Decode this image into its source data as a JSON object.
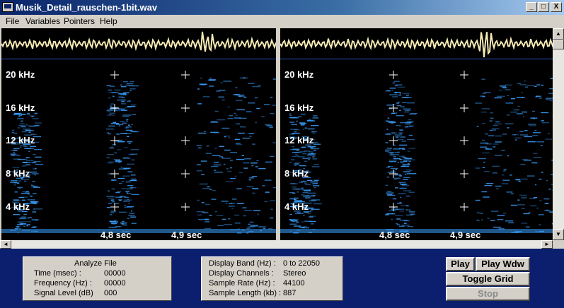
{
  "window": {
    "title": "Musik_Detail_rauschen-1bit.wav",
    "minimize": "_",
    "maximize": "□",
    "close": "X"
  },
  "menu": {
    "items": [
      "File",
      "Variables",
      "Pointers",
      "Help"
    ]
  },
  "spectrogram": {
    "freq_labels": [
      "20 kHz",
      "16 kHz",
      "12 kHz",
      "8  kHz",
      "4  kHz"
    ],
    "time_labels": [
      "4,8 sec",
      "4,9 sec"
    ],
    "colors": {
      "background": "#000000",
      "energy": "#3aa0ff",
      "waveform": "#f5eab4"
    }
  },
  "analyze": {
    "title": "Analyze File",
    "rows": [
      {
        "label": "Time (msec) :",
        "value": "00000"
      },
      {
        "label": "Frequency (Hz) :",
        "value": "00000"
      },
      {
        "label": "Signal Level (dB)",
        "value": "000"
      }
    ]
  },
  "display": {
    "rows": [
      {
        "label": "Display Band (Hz) :",
        "value": "0 to 22050"
      },
      {
        "label": "Display Channels :",
        "value": "Stereo"
      },
      {
        "label": "Sample Rate (Hz) :",
        "value": "44100"
      },
      {
        "label": "Sample Length (kb) :",
        "value": "887"
      }
    ]
  },
  "buttons": {
    "play": "Play",
    "play_wdw": "Play Wdw",
    "toggle_grid": "Toggle Grid",
    "stop": "Stop"
  },
  "scroll": {
    "up": "▲",
    "down": "▼",
    "left": "◄",
    "right": "►"
  }
}
